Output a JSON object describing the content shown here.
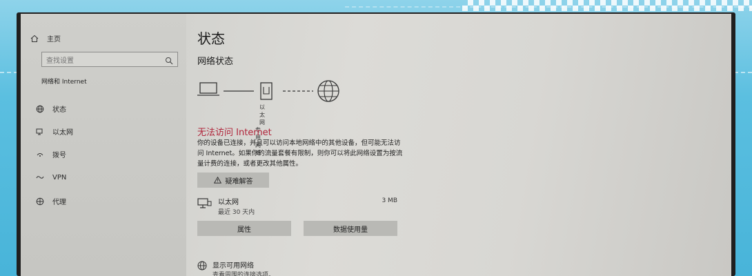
{
  "sidebar": {
    "home_label": "主页",
    "search_placeholder": "查找设置",
    "section_title": "网络和 Internet",
    "items": [
      {
        "label": "状态",
        "icon": "globe-icon"
      },
      {
        "label": "以太网",
        "icon": "ethernet-icon"
      },
      {
        "label": "拨号",
        "icon": "dialup-icon"
      },
      {
        "label": "VPN",
        "icon": "vpn-icon"
      },
      {
        "label": "代理",
        "icon": "proxy-icon"
      }
    ]
  },
  "main": {
    "title": "状态",
    "subtitle": "网络状态",
    "diagram": {
      "adapter_label_line1": "以太网",
      "adapter_label_line2": "专用网络"
    },
    "error_title": "无法访问 Internet",
    "error_description": "你的设备已连接，并且可以访问本地网络中的其他设备，但可能无法访问 Internet。如果你的流量套餐有限制，则你可以将此网络设置为按流量计费的连接，或者更改其他属性。",
    "troubleshoot_label": "疑难解答",
    "connection": {
      "name": "以太网",
      "time": "最近 30 天内",
      "size": "3 MB"
    },
    "properties_label": "属性",
    "data_usage_label": "数据使用量",
    "available": {
      "title": "显示可用网络",
      "subtitle": "查看周围的连接选项。"
    }
  },
  "colors": {
    "error": "#b0243a",
    "background": "#5bbfe0"
  }
}
